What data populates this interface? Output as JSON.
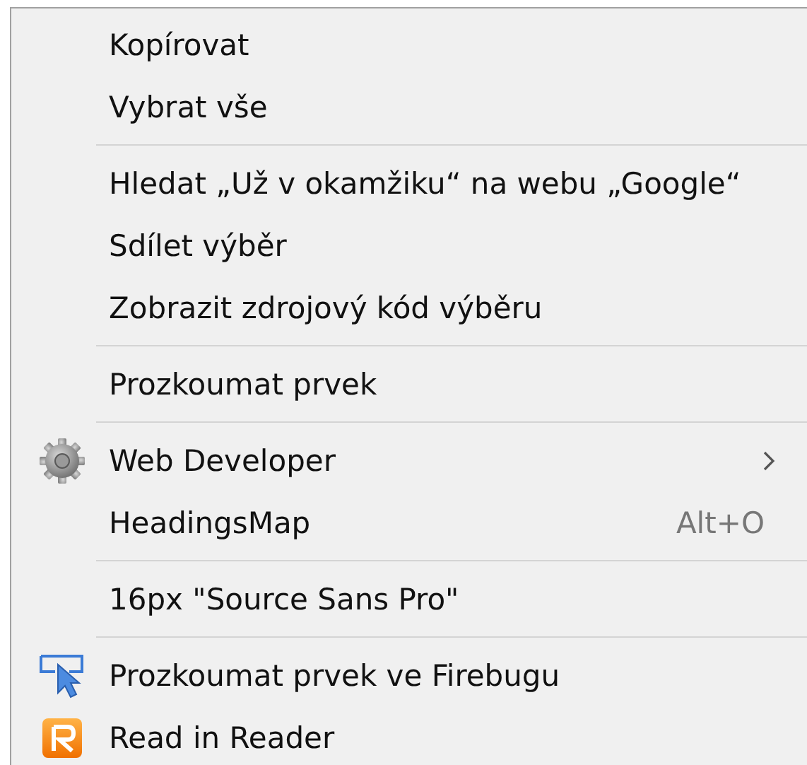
{
  "context_menu": {
    "items": [
      {
        "kind": "item",
        "label": "Kopírovat"
      },
      {
        "kind": "item",
        "label": "Vybrat vše"
      },
      {
        "kind": "separator"
      },
      {
        "kind": "item",
        "label": "Hledat „Už v okamžiku“ na webu „Google“"
      },
      {
        "kind": "item",
        "label": "Sdílet výběr"
      },
      {
        "kind": "item",
        "label": "Zobrazit zdrojový kód výběru"
      },
      {
        "kind": "separator"
      },
      {
        "kind": "item",
        "label": "Prozkoumat prvek"
      },
      {
        "kind": "separator"
      },
      {
        "kind": "gear",
        "label": "Web Developer",
        "submenu": true
      },
      {
        "kind": "item",
        "label": "HeadingsMap",
        "shortcut": "Alt+O"
      },
      {
        "kind": "separator"
      },
      {
        "kind": "item",
        "label": "16px \"Source Sans Pro\""
      },
      {
        "kind": "separator"
      },
      {
        "kind": "pointer",
        "label": "Prozkoumat prvek ve Firebugu"
      },
      {
        "kind": "reader",
        "label": "Read in Reader"
      }
    ]
  }
}
